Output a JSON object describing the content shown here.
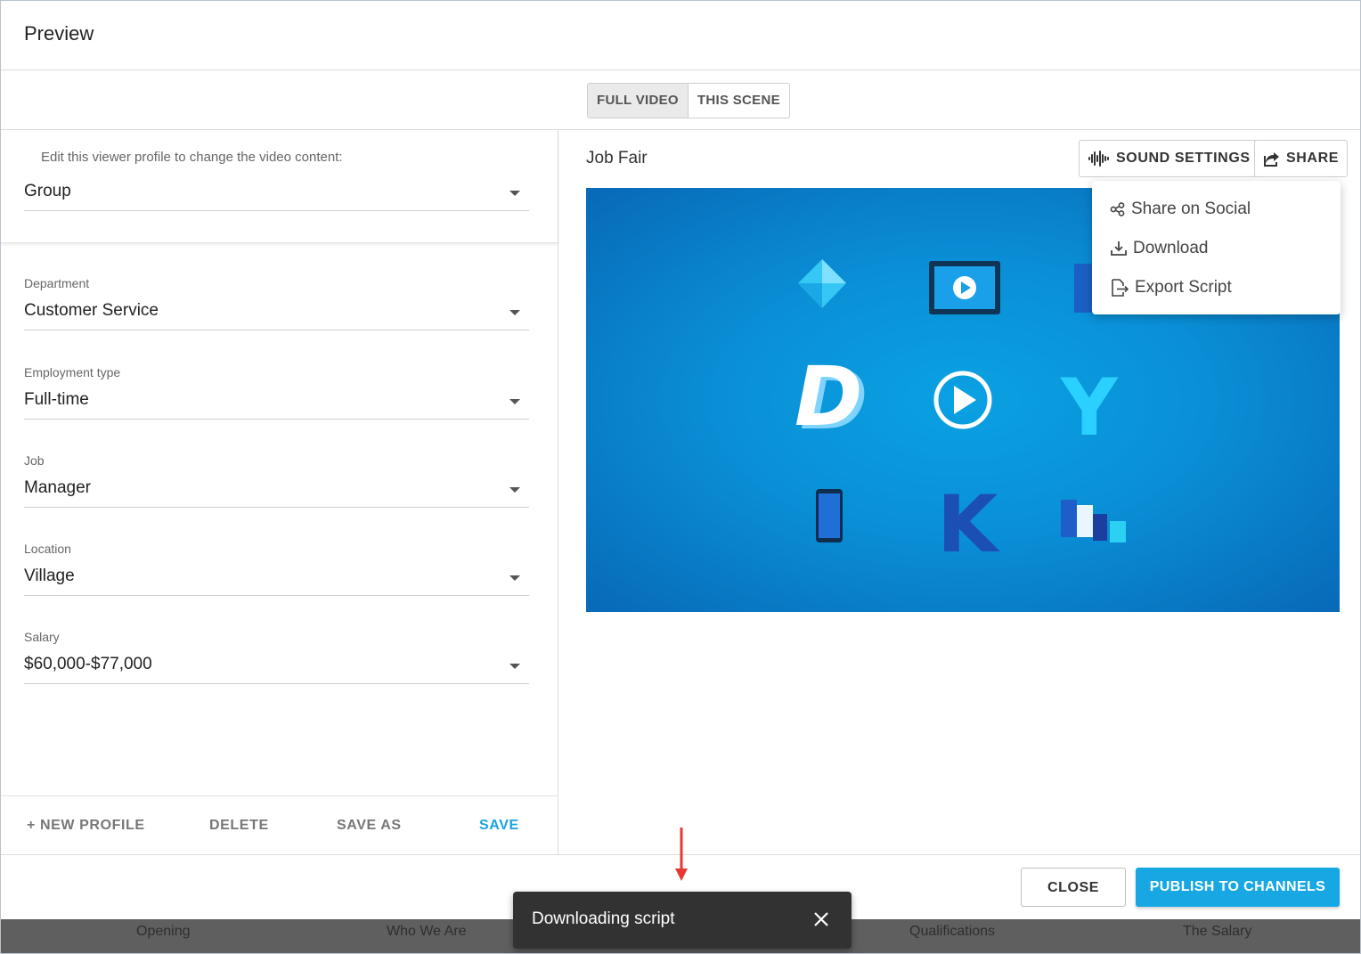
{
  "dialog": {
    "title": "Preview"
  },
  "view_toggle": {
    "options": [
      "FULL VIDEO",
      "THIS SCENE"
    ],
    "selected": "FULL VIDEO"
  },
  "profile": {
    "hint": "Edit this viewer profile to change the video content:",
    "selected": "Group"
  },
  "fields": [
    {
      "label": "Department",
      "value": "Customer Service"
    },
    {
      "label": "Employment type",
      "value": "Full-time"
    },
    {
      "label": "Job",
      "value": "Manager"
    },
    {
      "label": "Location",
      "value": "Village"
    },
    {
      "label": "Salary",
      "value": "$60,000-$77,000"
    }
  ],
  "profile_actions": {
    "new_profile": "+ NEW PROFILE",
    "delete": "DELETE",
    "save_as": "SAVE AS",
    "save": "SAVE"
  },
  "video": {
    "title": "Job Fair",
    "sound_settings_label": "SOUND SETTINGS",
    "share_label": "SHARE",
    "letters": [
      "D",
      "Y",
      "K"
    ]
  },
  "share_menu": {
    "items": [
      {
        "label": "Share on Social",
        "icon": "share-nodes-icon"
      },
      {
        "label": "Download",
        "icon": "download-icon"
      },
      {
        "label": "Export Script",
        "icon": "export-icon"
      }
    ]
  },
  "footer": {
    "close_label": "CLOSE",
    "publish_label": "PUBLISH TO CHANNELS"
  },
  "scenes": [
    "Opening",
    "Who We Are",
    "Qualifications",
    "The Salary"
  ],
  "toast": {
    "message": "Downloading script"
  },
  "colors": {
    "accent": "#17a8e4",
    "video_bg": "#0a8fd6",
    "toast_bg": "#323232",
    "annotation_arrow": "#e53935"
  }
}
